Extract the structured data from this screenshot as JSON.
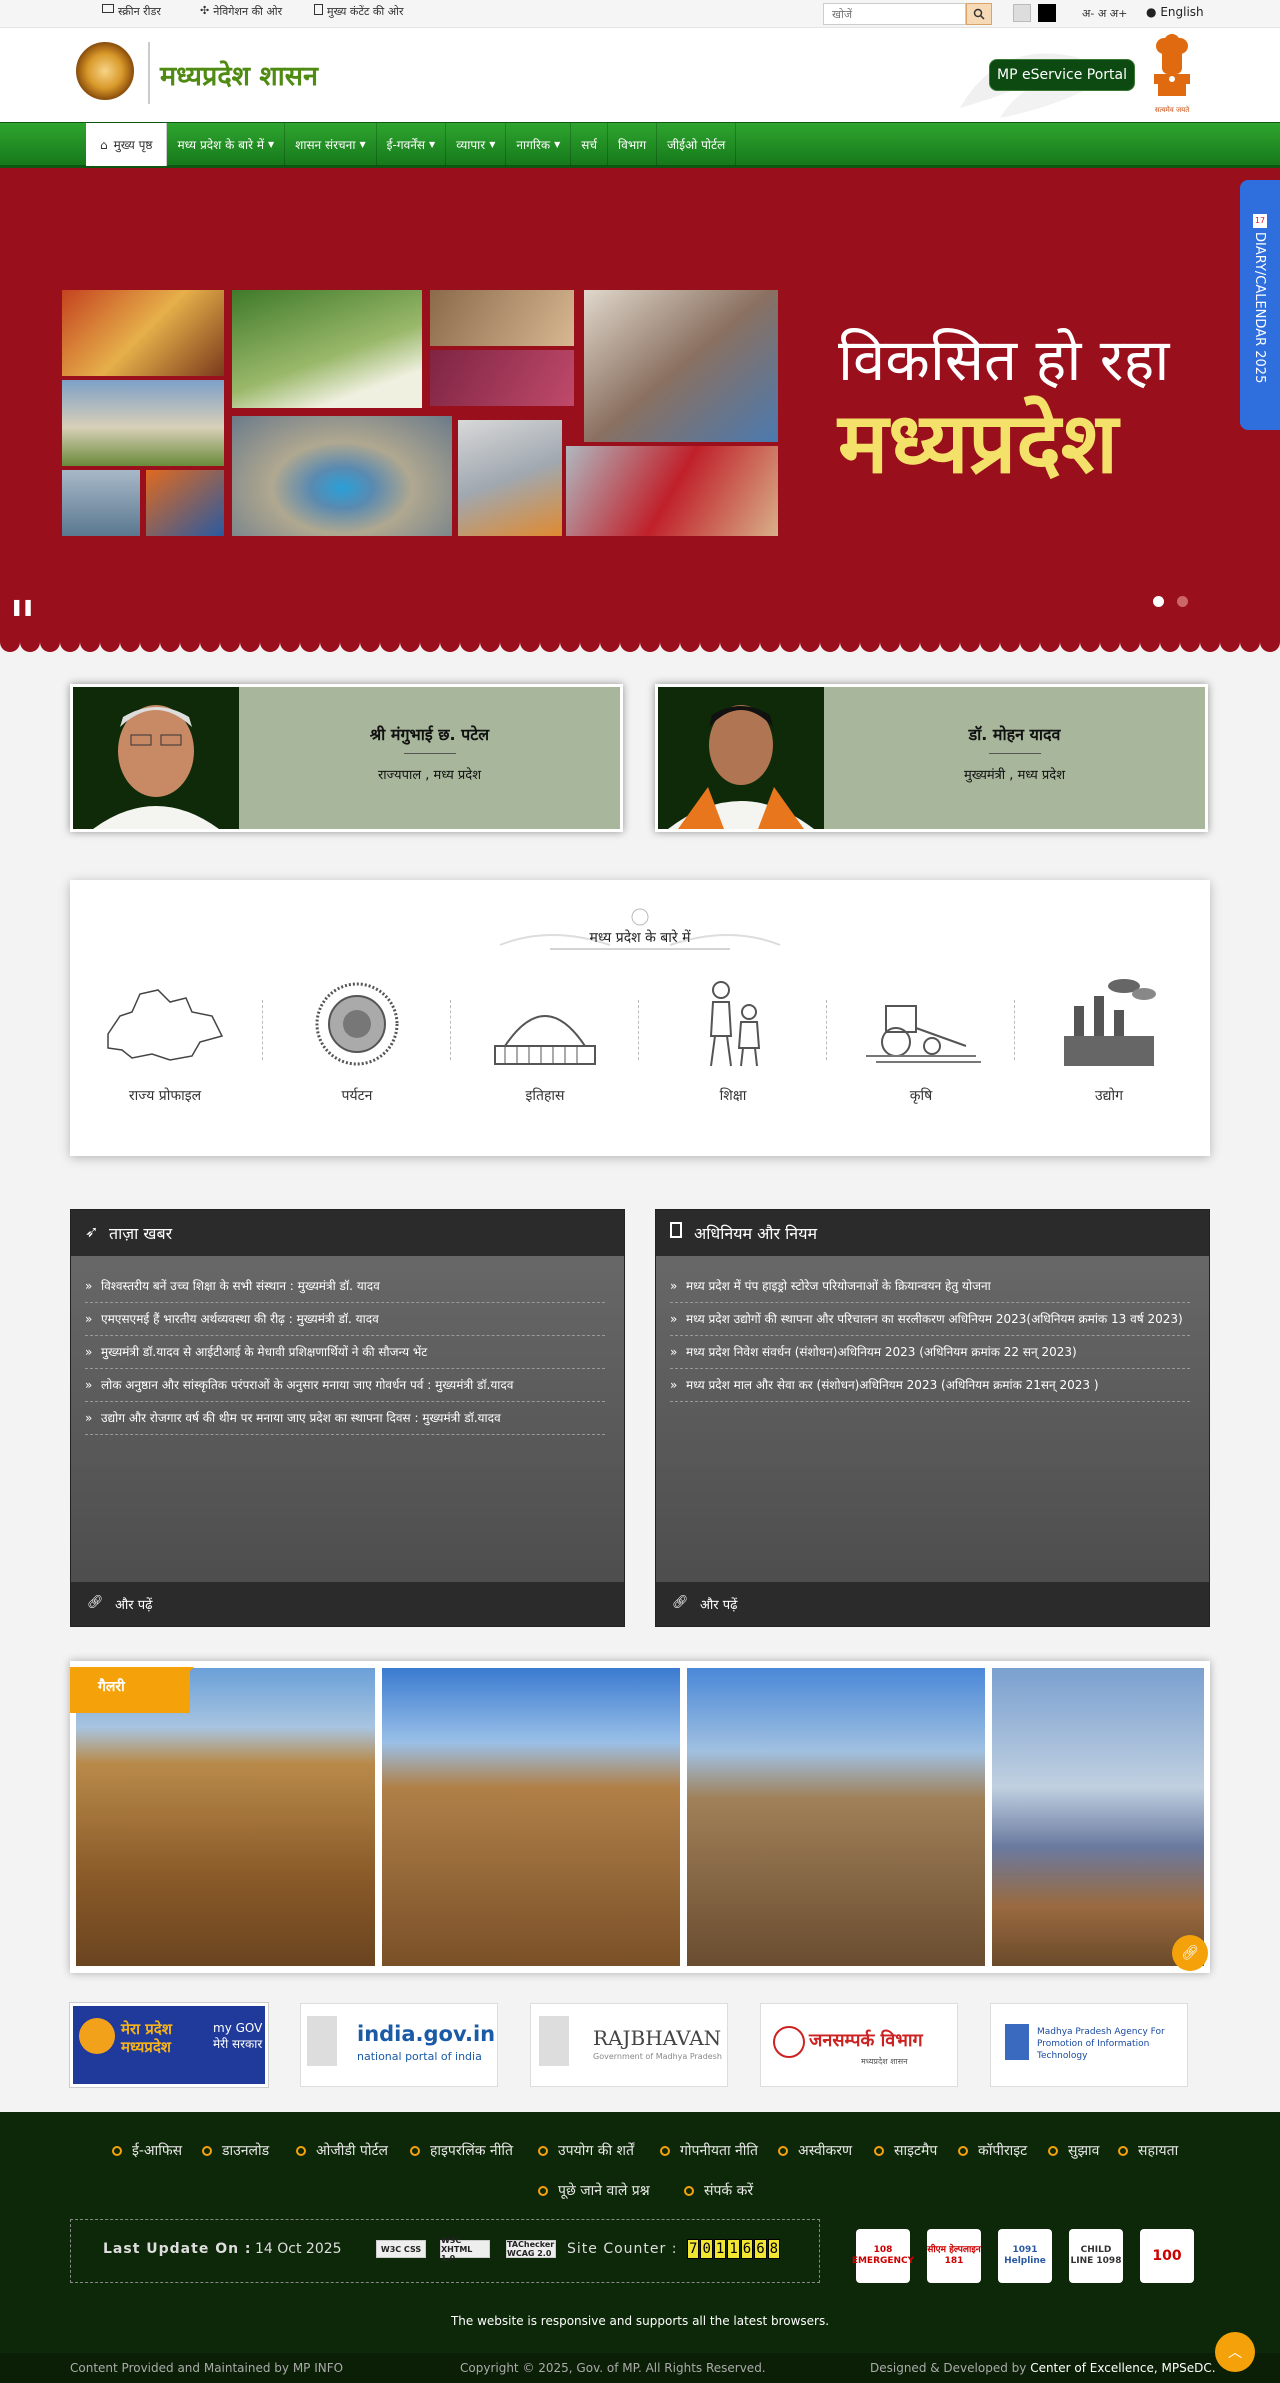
{
  "topbar": {
    "screen_reader": "स्क्रीन रीडर",
    "nav_link": "नेविगेशन की ओर",
    "main_content_link": "मुख्य कंटेंट की ओर",
    "search_placeholder": "खोजें",
    "font_size": "अ- अ अ+",
    "language": "English"
  },
  "header": {
    "site_name": "मध्यप्रदेश शासन",
    "eservice_button": "MP eService Portal",
    "emblem_caption": "सत्यमेव जयते"
  },
  "nav": {
    "items": [
      {
        "label": "मुख्य पृष्ठ"
      },
      {
        "label": "मध्य प्रदेश के बारे में"
      },
      {
        "label": "शासन संरचना"
      },
      {
        "label": "ई-गवर्नेंस"
      },
      {
        "label": "व्यापार"
      },
      {
        "label": "नागरिक"
      },
      {
        "label": "सर्च"
      },
      {
        "label": "विभाग"
      },
      {
        "label": "जीईओ पोर्टल"
      }
    ]
  },
  "slider": {
    "line1": "विकसित हो रहा",
    "line2": "मध्यप्रदेश",
    "colors": {
      "background": "#990f1c",
      "accent": "#f3e16a"
    }
  },
  "diary": {
    "label": "DIARY/CALENDAR 2025",
    "day": "17"
  },
  "leaders": [
    {
      "name": "श्री मंगुभाई छ. पटेल",
      "role": "राज्यपाल , मध्य प्रदेश"
    },
    {
      "name": "डॉ. मोहन यादव",
      "role": "मुख्यमंत्री , मध्य प्रदेश"
    }
  ],
  "about": {
    "title": "मध्य प्रदेश के बारे में",
    "items": [
      {
        "label": "राज्य प्रोफाइल",
        "icon": "map-icon"
      },
      {
        "label": "पर्यटन",
        "icon": "seal-icon"
      },
      {
        "label": "इतिहास",
        "icon": "monument-icon"
      },
      {
        "label": "शिक्षा",
        "icon": "children-icon"
      },
      {
        "label": "कृषि",
        "icon": "tractor-icon"
      },
      {
        "label": "उद्योग",
        "icon": "factory-icon"
      }
    ]
  },
  "news": {
    "title": "ताज़ा खबर",
    "items": [
      "विश्वस्तरीय बनें उच्च शिक्षा के सभी संस्थान : मुख्यमंत्री डॉ. यादव",
      "एमएसएमई हैं भारतीय अर्थव्यवस्था की रीढ़ : मुख्यमंत्री डॉ. यादव",
      "मुख्यमंत्री डॉ.यादव से आईटीआई के मेधावी प्रशिक्षणार्थियों ने की सौजन्य भेंट",
      "लोक अनुष्ठान और सांस्कृतिक परंपराओं के अनुसार मनाया जाए गोवर्धन पर्व : मुख्यमंत्री डॉ.यादव",
      "उद्योग और रोजगार वर्ष की थीम पर मनाया जाए प्रदेश का स्थापना दिवस : मुख्यमंत्री डॉ.यादव"
    ],
    "more": "और पढ़ें"
  },
  "acts": {
    "title": "अधिनियम और नियम",
    "items": [
      "मध्य प्रदेश में पंप हाइड्रो स्टोरेज परियोजनाओं के क्रियान्वयन हेतु योजना",
      "मध्य प्रदेश उद्योगों की स्थापना और परिचालन का सरलीकरण अधिनियम 2023(अधिनियम क्रमांक 13 वर्ष 2023)",
      "मध्य प्रदेश निवेश संवर्धन (संशोधन)अधिनियम 2023 (अधिनियम क्रमांक 22 सन् 2023)",
      "मध्य प्रदेश माल और सेवा कर (संशोधन)अधिनियम 2023 (अधिनियम क्रमांक 21सन् 2023 )"
    ],
    "more": "और पढ़ें"
  },
  "gallery": {
    "tag": "गैलरी"
  },
  "partners": [
    {
      "name": "मेरा प्रदेश मध्यप्रदेश",
      "sub": "my GOV मेरी सरकार"
    },
    {
      "name": "india.gov.in",
      "sub": "national portal of india"
    },
    {
      "name": "RAJBHAVAN",
      "sub": "Government of Madhya Pradesh"
    },
    {
      "name": "जनसम्पर्क विभाग",
      "sub": "मध्यप्रदेश शासन"
    },
    {
      "name": "Madhya Pradesh Agency For Promotion of Information Technology",
      "sub": ""
    }
  ],
  "footer": {
    "links_row1": [
      "ई-आफिस",
      "डाउनलोड",
      "ओजीडी पोर्टल",
      "हाइपरलिंक नीति",
      "उपयोग की शर्तें",
      "गोपनीयता नीति",
      "अस्वीकरण",
      "साइटमैप",
      "कॉपीराइट",
      "सुझाव",
      "सहायता"
    ],
    "links_row2": [
      "पूछे जाने वाले प्रश्न",
      "संपर्क करें"
    ],
    "last_update_label": "Last Update On :",
    "last_update_value": "14 Oct 2025",
    "badges": [
      "W3C CSS",
      "W3C XHTML 1.0",
      "TAChecker WCAG 2.0"
    ],
    "counter_label": "Site Counter :",
    "counter_digits": [
      "7",
      "0",
      "1",
      "1",
      "6",
      "6",
      "8"
    ],
    "helplines": [
      "108 EMERGENCY",
      "सीएम हेल्पलाइन 181",
      "1091 Helpline",
      "CHILD LINE 1098",
      "100"
    ],
    "responsive_note": "The website is responsive and supports all the latest browsers.",
    "maintained": "Content Provided and Maintained by MP INFO",
    "copyright": "Copyright © 2025, Gov. of MP. All Rights Reserved.",
    "designed_prefix": "Designed & Developed by",
    "designed_by": "Center of Excellence, MPSeDC."
  }
}
